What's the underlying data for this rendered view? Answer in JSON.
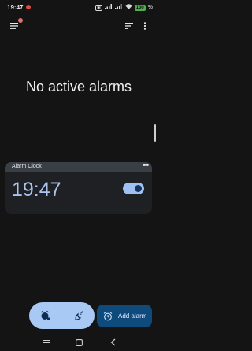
{
  "status": {
    "time": "19:47",
    "icons": [
      "vpn-icon",
      "hd-icon",
      "signal-4g-icon",
      "signal-icon",
      "wifi-icon"
    ],
    "battery": "100"
  },
  "app_bar": {
    "icons": [
      "menu-icon",
      "sort-icon",
      "more-vert-icon"
    ]
  },
  "main": {
    "empty_message": "No active alarms"
  },
  "widget": {
    "title": "Alarm Clock",
    "time": "19:47",
    "enabled": true
  },
  "bottom": {
    "add_alarm_label": "Add alarm",
    "fab_icons": [
      "alarm-snooze-icon",
      "sleep-icon"
    ]
  },
  "colors": {
    "background": "#141414",
    "widget_header": "#3a3e45",
    "accent": "#a9c9f5",
    "add_button": "#0f4a7c",
    "time_text": "#aac4ee"
  }
}
